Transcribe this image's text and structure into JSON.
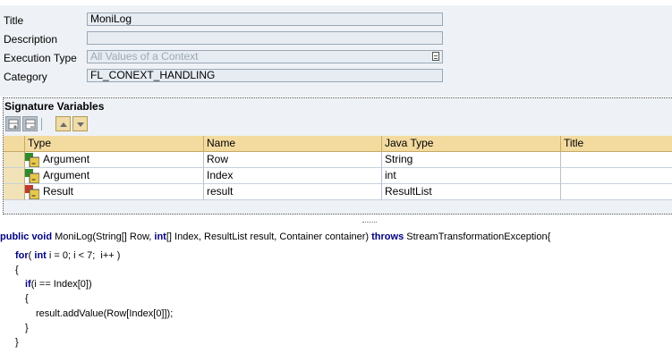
{
  "form": {
    "title_label": "Title",
    "title_value": "MoniLog",
    "description_label": "Description",
    "description_value": "",
    "execution_type_label": "Execution Type",
    "execution_type_value": "All Values of a Context",
    "category_label": "Category",
    "category_value": "FL_CONEXT_HANDLING"
  },
  "signature": {
    "title": "Signature Variables",
    "columns": [
      "Type",
      "Name",
      "Java Type",
      "Title"
    ],
    "rows": [
      {
        "type": "Argument",
        "name": "Row",
        "java_type": "String",
        "title": "",
        "icon": "argument-icon"
      },
      {
        "type": "Argument",
        "name": "Index",
        "java_type": "int",
        "title": "",
        "icon": "argument-icon"
      },
      {
        "type": "Result",
        "name": "result",
        "java_type": "ResultList",
        "title": "",
        "icon": "result-icon"
      }
    ]
  },
  "code": {
    "line1_kw1": "public void",
    "line1_a": " MoniLog(String[] Row, ",
    "line1_kw2": "int",
    "line1_b": "[] Index, ResultList result, Container container) ",
    "line1_kw3": "throws",
    "line1_c": " StreamTransformationException{",
    "line2_kw": "for",
    "line2_a": "( ",
    "line2_kw2": "int",
    "line2_b": " i = 0; i < 7;  i++ )",
    "line3": "{",
    "line4_kw": "if",
    "line4_a": "(i == Index[0])",
    "line5": "{",
    "line6": "result.addValue(Row[Index[0]]);",
    "line7": "}",
    "line8": "}"
  },
  "colors": {
    "keyword": "#000080",
    "header_bg": "#f3dba0",
    "panel_bg": "#eef1f5"
  }
}
